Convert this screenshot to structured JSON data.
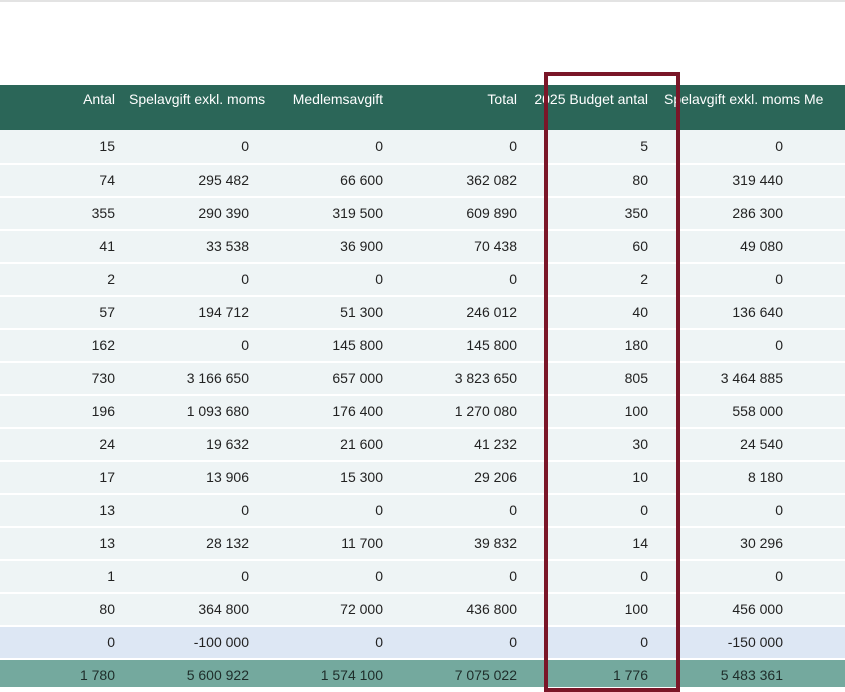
{
  "columns": [
    "Antal",
    "Spelavgift exkl. moms",
    "Medlemsavgift",
    "Total",
    "2025 Budget antal",
    "Spelavgift exkl. moms",
    "Me"
  ],
  "rows": [
    [
      "15",
      "0",
      "0",
      "0",
      "5",
      "0"
    ],
    [
      "74",
      "295 482",
      "66 600",
      "362 082",
      "80",
      "319 440"
    ],
    [
      "355",
      "290 390",
      "319 500",
      "609 890",
      "350",
      "286 300"
    ],
    [
      "41",
      "33 538",
      "36 900",
      "70 438",
      "60",
      "49 080"
    ],
    [
      "2",
      "0",
      "0",
      "0",
      "2",
      "0"
    ],
    [
      "57",
      "194 712",
      "51 300",
      "246 012",
      "40",
      "136 640"
    ],
    [
      "162",
      "0",
      "145 800",
      "145 800",
      "180",
      "0"
    ],
    [
      "730",
      "3 166 650",
      "657 000",
      "3 823 650",
      "805",
      "3 464 885"
    ],
    [
      "196",
      "1 093 680",
      "176 400",
      "1 270 080",
      "100",
      "558 000"
    ],
    [
      "24",
      "19 632",
      "21 600",
      "41 232",
      "30",
      "24 540"
    ],
    [
      "17",
      "13 906",
      "15 300",
      "29 206",
      "10",
      "8 180"
    ],
    [
      "13",
      "0",
      "0",
      "0",
      "0",
      "0"
    ],
    [
      "13",
      "28 132",
      "11 700",
      "39 832",
      "14",
      "30 296"
    ],
    [
      "1",
      "0",
      "0",
      "0",
      "0",
      "0"
    ],
    [
      "80",
      "364 800",
      "72 000",
      "436 800",
      "100",
      "456 000"
    ],
    [
      "0",
      "-100 000",
      "0",
      "0",
      "0",
      "-150 000"
    ]
  ],
  "totals": [
    "1 780",
    "5 600 922",
    "1 574 100",
    "7 075 022",
    "1 776",
    "5 483 361"
  ],
  "colors": {
    "header_bg": "#2b6658",
    "row_bg": "#eef4f5",
    "adjustment_row_bg": "#dde7f4",
    "total_bg": "#74a99e",
    "highlight_border": "#7a1628"
  }
}
